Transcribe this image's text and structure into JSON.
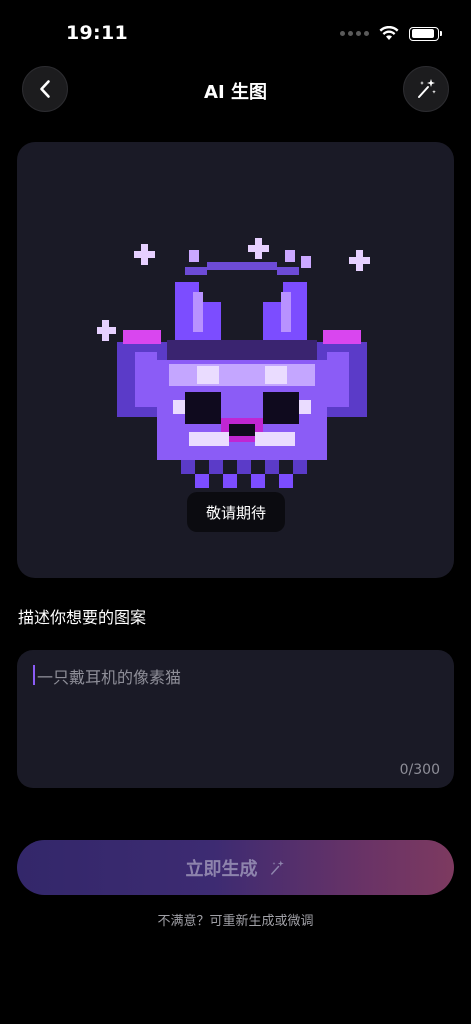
{
  "status_bar": {
    "time": "19:11",
    "battery_level": 0.9
  },
  "header": {
    "title": "AI 生图",
    "back_icon": "chevron-left-icon",
    "action_icon": "magic-wand-icon"
  },
  "preview": {
    "badge": "敬请期待",
    "image": "pixel-cat-illustration"
  },
  "prompt": {
    "section_label": "描述你想要的图案",
    "placeholder": "一只戴耳机的像素猫",
    "char_count": "0/300"
  },
  "generate": {
    "label": "立即生成",
    "icon": "magic-wand-icon"
  },
  "hint": "不满意？可重新生成或微调",
  "colors": {
    "background": "#000000",
    "card": "#1a1a26",
    "accent": "#8b5cf6",
    "gradient_start": "#33276a",
    "gradient_end": "#7d3a60"
  }
}
